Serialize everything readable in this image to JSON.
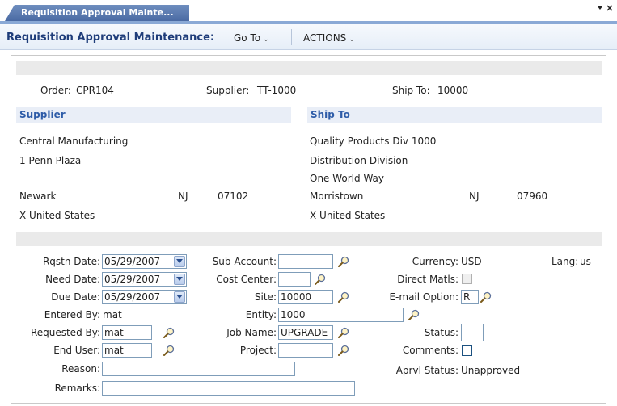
{
  "tab": {
    "label": "Requisition Approval Mainte..."
  },
  "toolbar": {
    "title": "Requisition Approval Maintenance:",
    "goto_label": "Go To",
    "actions_label": "ACTIONS"
  },
  "order": {
    "order_label": "Order:",
    "order_value": "CPR104",
    "supplier_label": "Supplier:",
    "supplier_value": "TT-1000",
    "shipto_label": "Ship To:",
    "shipto_value": "10000"
  },
  "supplier": {
    "header": "Supplier",
    "name": "Central Manufacturing",
    "address1": "1 Penn Plaza",
    "city": "Newark",
    "state": "NJ",
    "zip": "07102",
    "country": "X United States"
  },
  "ship_to": {
    "header": "Ship To",
    "name": "Quality Products Div 1000",
    "address1": "Distribution Division",
    "address2": "One World Way",
    "city": "Morristown",
    "state": "NJ",
    "zip": "07960",
    "country": "X United States"
  },
  "form": {
    "rqstn_date_label": "Rqstn Date:",
    "rqstn_date": "05/29/2007",
    "need_date_label": "Need Date:",
    "need_date": "05/29/2007",
    "due_date_label": "Due Date:",
    "due_date": "05/29/2007",
    "entered_by_label": "Entered By:",
    "entered_by": "mat",
    "requested_by_label": "Requested By:",
    "requested_by": "mat",
    "end_user_label": "End User:",
    "end_user": "mat",
    "reason_label": "Reason:",
    "reason": "",
    "remarks_label": "Remarks:",
    "remarks": "",
    "sub_account_label": "Sub-Account:",
    "sub_account": "",
    "cost_center_label": "Cost Center:",
    "cost_center": "",
    "site_label": "Site:",
    "site": "10000",
    "entity_label": "Entity:",
    "entity": "1000",
    "job_name_label": "Job Name:",
    "job_name": "UPGRADE",
    "project_label": "Project:",
    "project": "",
    "currency_label": "Currency:",
    "currency": "USD",
    "lang_label": "Lang:",
    "lang": "us",
    "direct_matls_label": "Direct Matls:",
    "email_option_label": "E-mail Option:",
    "email_option": "R",
    "status_label": "Status:",
    "status": "",
    "comments_label": "Comments:",
    "aprvl_status_label": "Aprvl Status:",
    "aprvl_status": "Unapproved"
  },
  "icons": {
    "lookup": "magnifier-icon",
    "dropdown": "chevron-down-icon",
    "tab_menu": "tab-menu-icon"
  },
  "colors": {
    "accent": "#2e5ca8",
    "tab": "#4a6aa3",
    "title": "#1f3d7a"
  }
}
